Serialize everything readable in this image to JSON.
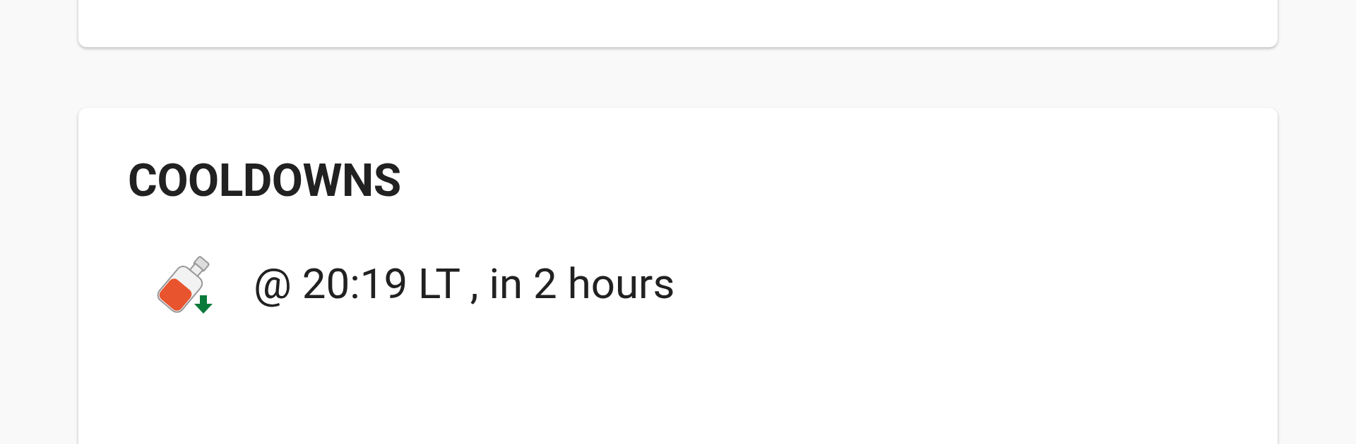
{
  "cooldowns": {
    "title": "COOLDOWNS",
    "items": [
      {
        "text": "@ 20:19 LT , in 2 hours"
      }
    ]
  }
}
